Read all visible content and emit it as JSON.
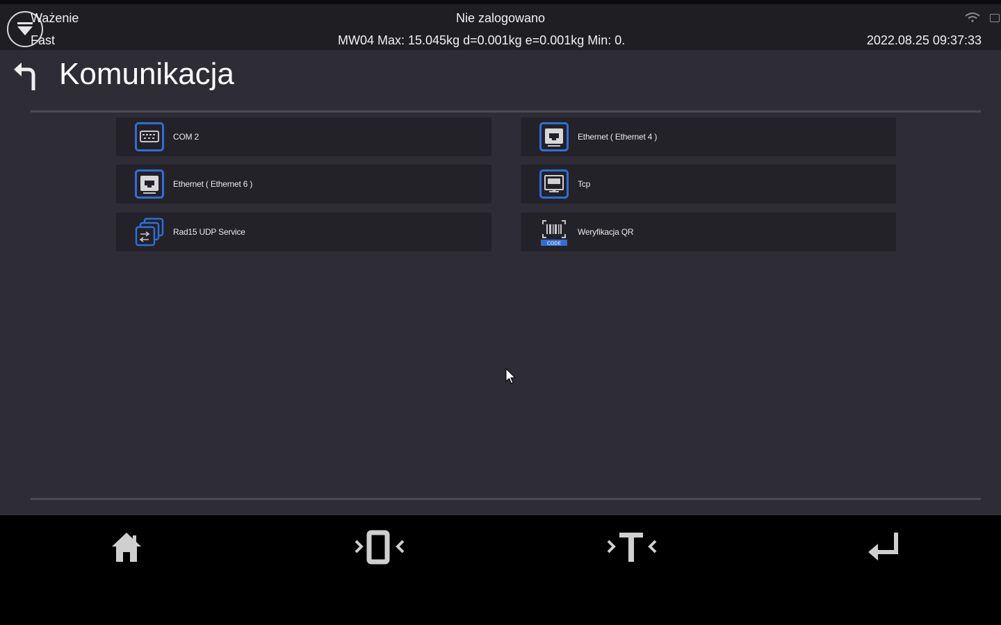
{
  "statusbar": {
    "mode_title": "Ważenie",
    "mode_sub": "Fast",
    "login_status": "Nie zalogowano",
    "scale_info": "MW04 Max: 15.045kg d=0.001kg e=0.001kg  Min: 0.",
    "datetime": "2022.08.25 09:37:33",
    "icons": [
      "mode-menu-icon",
      "wifi-icon",
      "keyboard-icon"
    ]
  },
  "page": {
    "title": "Komunikacja",
    "back_icon": "back-arrow-icon"
  },
  "items": [
    {
      "label": "COM 2",
      "icon": "serial-port-icon"
    },
    {
      "label": "Ethernet ( Ethernet 4 )",
      "icon": "ethernet-icon"
    },
    {
      "label": "Ethernet ( Ethernet 6 )",
      "icon": "ethernet-icon"
    },
    {
      "label": "Tcp",
      "icon": "tcp-icon"
    },
    {
      "label": "Rad15 UDP Service",
      "icon": "udp-service-icon"
    },
    {
      "label": "Weryfikacja QR",
      "icon": "qr-code-icon"
    }
  ],
  "bottom_nav": [
    {
      "name": "home",
      "icon": "home-icon"
    },
    {
      "name": "zero",
      "icon": "zero-icon"
    },
    {
      "name": "tare",
      "icon": "tare-icon"
    },
    {
      "name": "enter",
      "icon": "enter-icon"
    }
  ],
  "colors": {
    "accent": "#2f6fd6",
    "background": "#2e2d36",
    "tile": "#242229",
    "statusbar": "#1f1e23"
  }
}
